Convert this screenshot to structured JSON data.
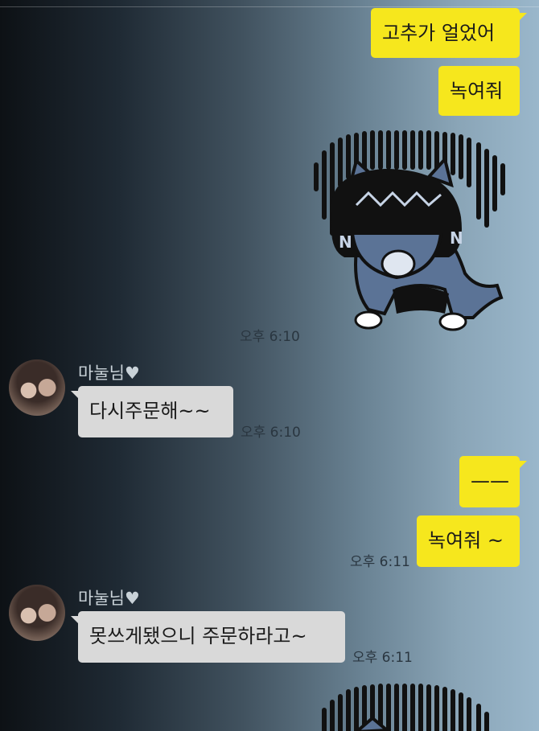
{
  "chat": {
    "messages": [
      {
        "sender": "me",
        "text": "고추가 얼었어"
      },
      {
        "sender": "me",
        "text": "녹여줘"
      },
      {
        "sender": "me",
        "sticker": "crying-cat-sticker-icon",
        "time": "오후 6:10"
      },
      {
        "sender": "마눌님♥",
        "text": "다시주문해~~",
        "time": "오후 6:10"
      },
      {
        "sender": "me",
        "text": "——"
      },
      {
        "sender": "me",
        "text": "녹여줘 ~",
        "time": "오후 6:11"
      },
      {
        "sender": "마눌님♥",
        "text": "못쓰게됐으니 주문하라고~",
        "time": "오후 6:11"
      },
      {
        "sender": "me",
        "sticker": "crying-cat-sticker-icon"
      }
    ]
  },
  "colors": {
    "my_bubble": "#f6e71d",
    "their_bubble": "#d9d9d9"
  }
}
